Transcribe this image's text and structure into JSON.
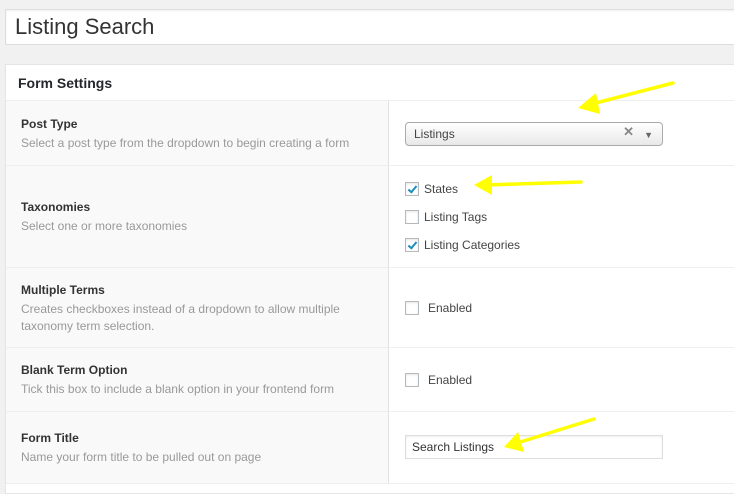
{
  "page_title": "Listing Search",
  "panel": {
    "title": "Form Settings"
  },
  "post_type": {
    "label": "Post Type",
    "description": "Select a post type from the dropdown to begin creating a form",
    "selected": "Listings",
    "clear_icon": "close-icon",
    "caret_icon": "caret-down-icon"
  },
  "taxonomies": {
    "label": "Taxonomies",
    "description": "Select one or more taxonomies",
    "options": [
      {
        "label": "States",
        "checked": true
      },
      {
        "label": "Listing Tags",
        "checked": false
      },
      {
        "label": "Listing Categories",
        "checked": true
      }
    ]
  },
  "multiple_terms": {
    "label": "Multiple Terms",
    "description": "Creates checkboxes instead of a dropdown to allow multiple taxonomy term selection.",
    "checkbox_label": "Enabled",
    "checked": false
  },
  "blank_term": {
    "label": "Blank Term Option",
    "description": "Tick this box to include a blank option in your frontend form",
    "checkbox_label": "Enabled",
    "checked": false
  },
  "form_title": {
    "label": "Form Title",
    "description": "Name your form title to be pulled out on page",
    "value": "Search Listings"
  },
  "annotation_color": "#ffff00"
}
